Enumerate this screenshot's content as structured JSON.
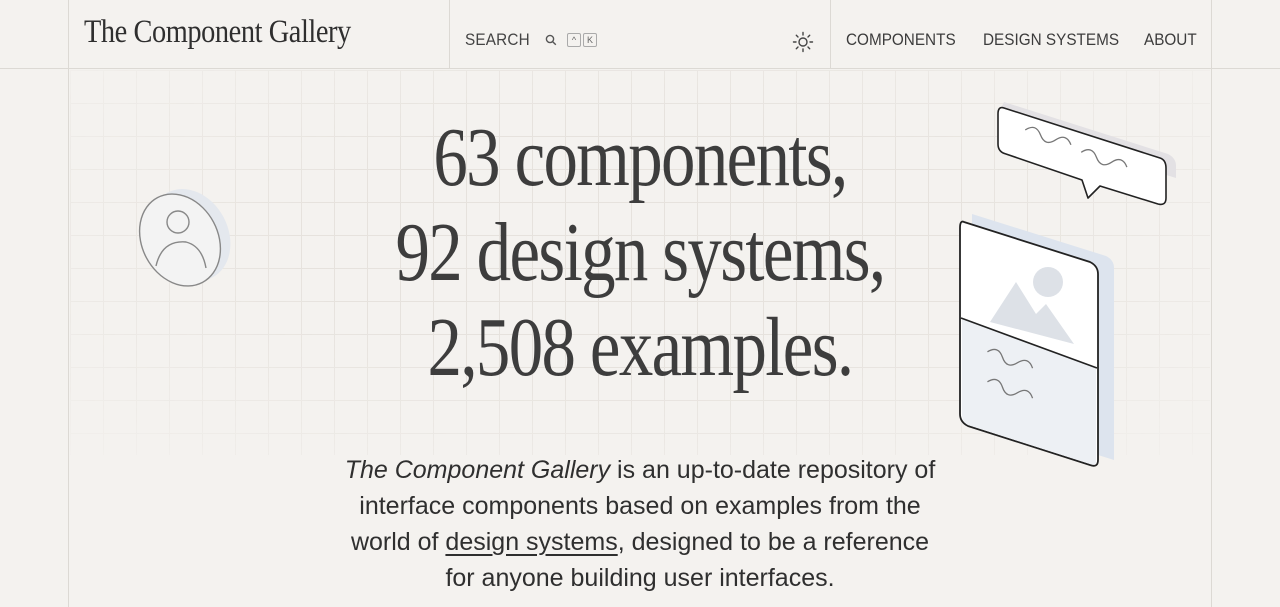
{
  "header": {
    "brand": "The Component Gallery",
    "search": {
      "label": "SEARCH",
      "shortcut_keys": [
        "^",
        "K"
      ]
    },
    "nav": [
      {
        "label": "COMPONENTS"
      },
      {
        "label": "DESIGN SYSTEMS"
      },
      {
        "label": "ABOUT"
      }
    ]
  },
  "hero": {
    "line1": "63 components,",
    "line2": "92 design systems,",
    "line3": "2,508 examples."
  },
  "intro": {
    "title_italic": "The Component Gallery",
    "text_a": " is an up-to-date repository of interface components based on examples from the world of ",
    "link": "design systems",
    "text_b": ", designed to be a reference for anyone building user interfaces."
  },
  "icons": {
    "search": "search-icon",
    "theme": "sun-icon",
    "avatar": "avatar-illustration",
    "speech": "speech-bubble-illustration",
    "card": "image-card-illustration"
  },
  "colors": {
    "background": "#f4f2ef",
    "text": "#3d3d3d",
    "lines": "#dcd9d4"
  }
}
